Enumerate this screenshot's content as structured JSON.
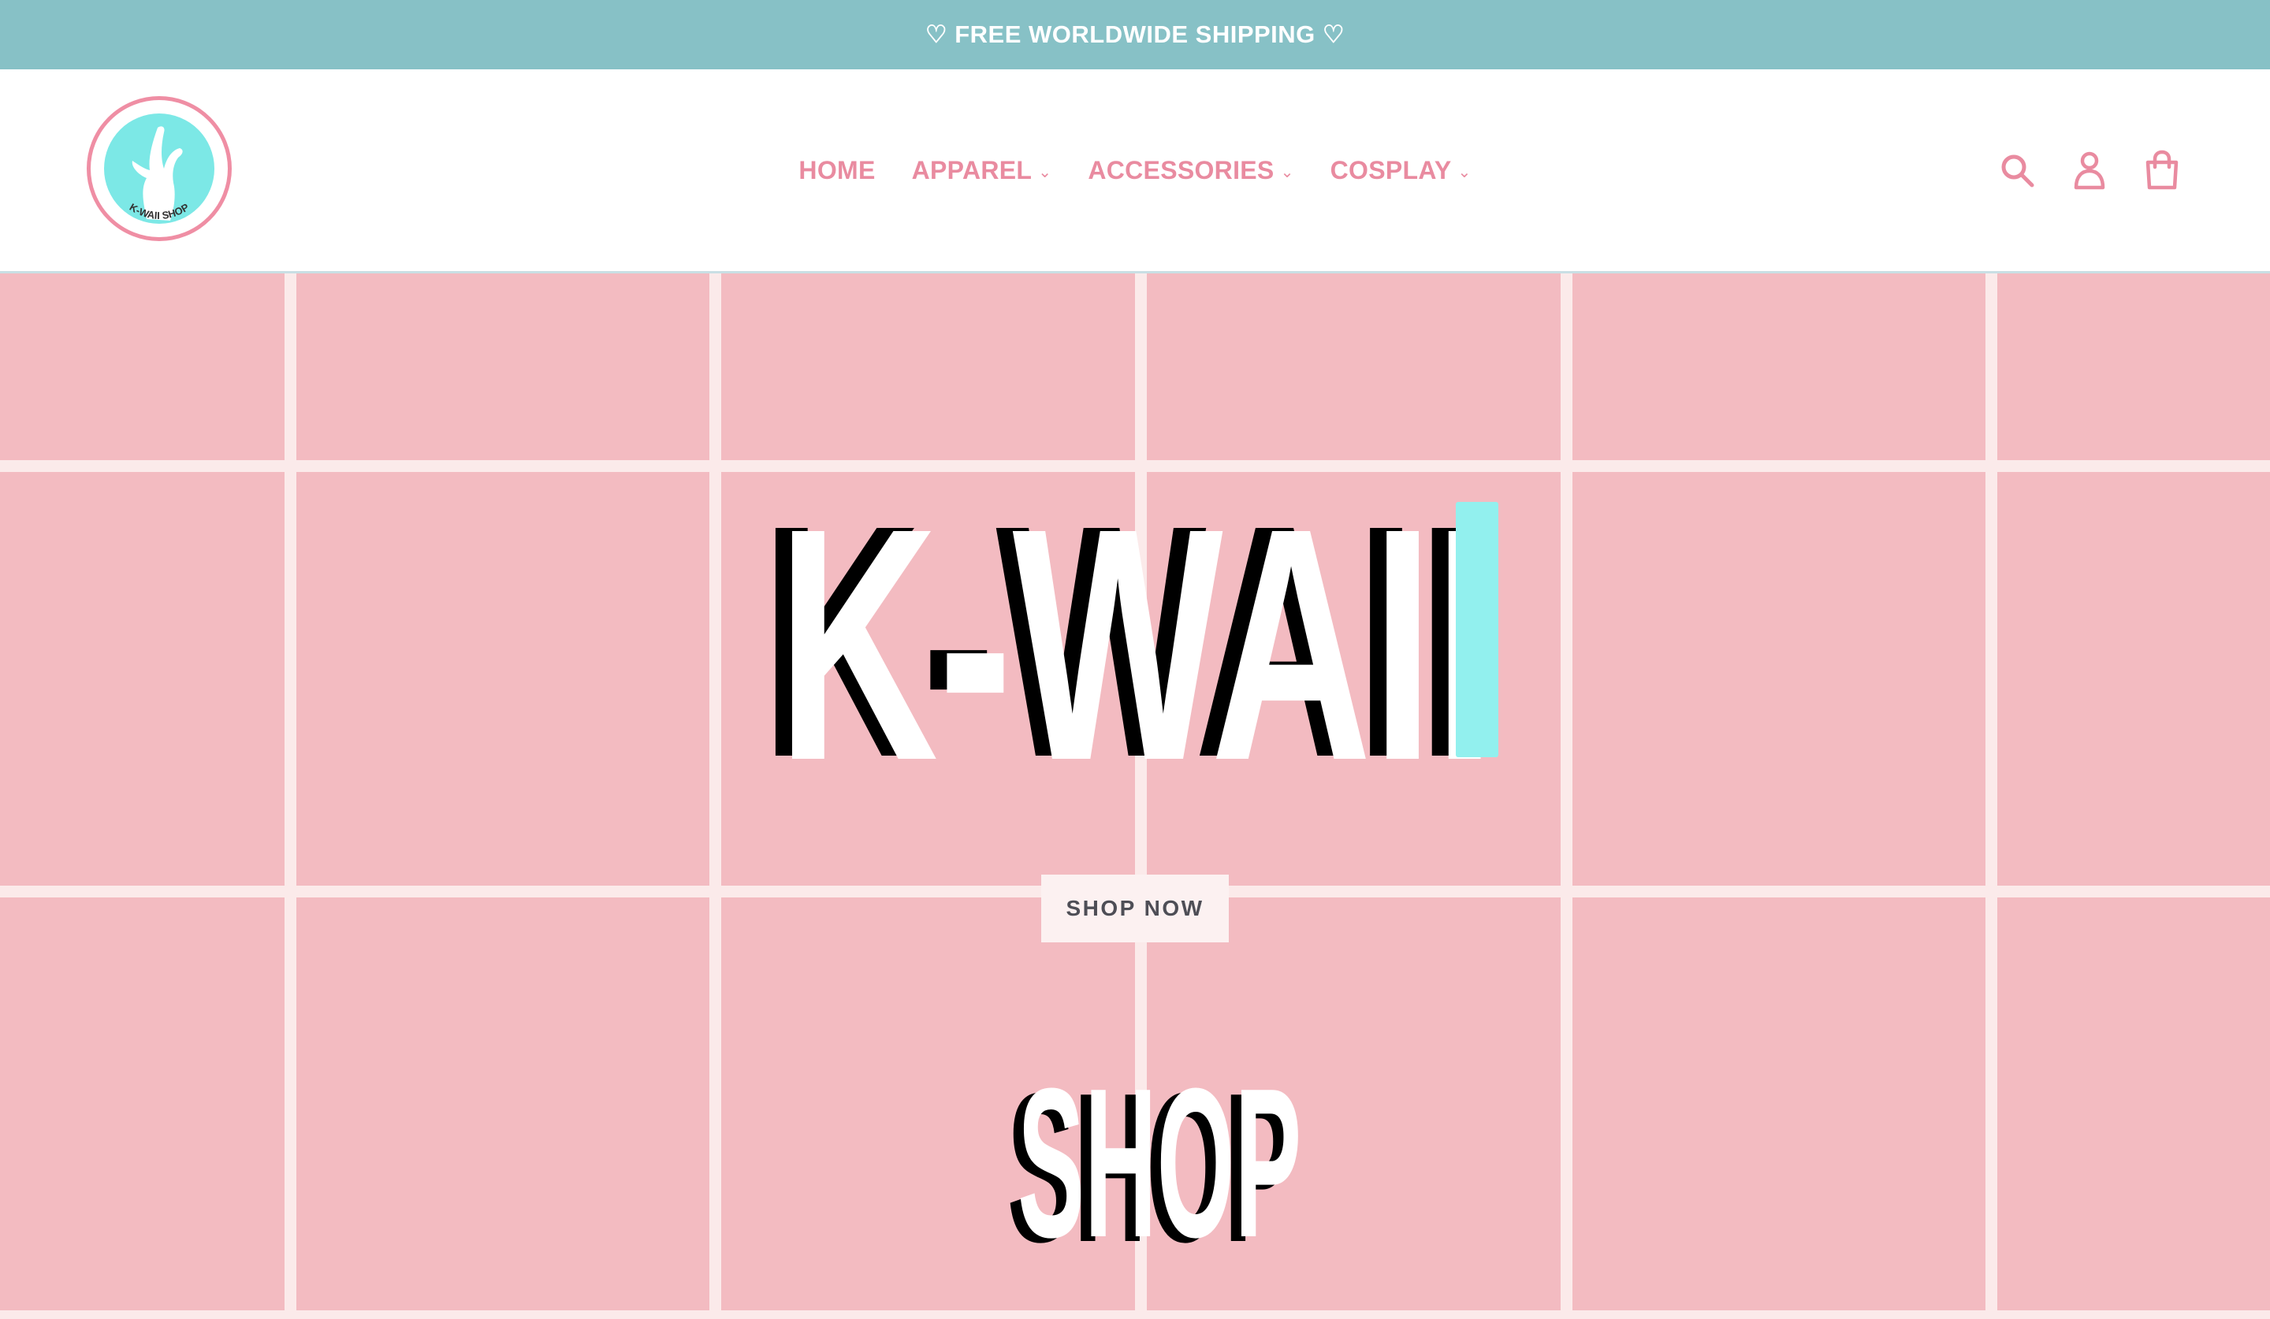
{
  "announcement": {
    "text": "♡ FREE WORLDWIDE SHIPPING ♡"
  },
  "header": {
    "logo_text": "K-WAII SHOP",
    "nav": [
      {
        "label": "HOME",
        "dropdown": false
      },
      {
        "label": "APPAREL",
        "dropdown": true
      },
      {
        "label": "ACCESSORIES",
        "dropdown": true
      },
      {
        "label": "COSPLAY",
        "dropdown": true
      }
    ],
    "icons": [
      "search-icon",
      "account-icon",
      "cart-icon"
    ]
  },
  "hero": {
    "title_text": "K-WAII",
    "subtitle_text": "SHOP",
    "button_label": "SHOP NOW"
  },
  "colors": {
    "announcement_bg": "#87c1c6",
    "nav_pink": "#e98ba0",
    "hero_pink": "#f3bbc1",
    "grid_line": "#fbeaea",
    "accent_cyan": "#92f0ee"
  }
}
